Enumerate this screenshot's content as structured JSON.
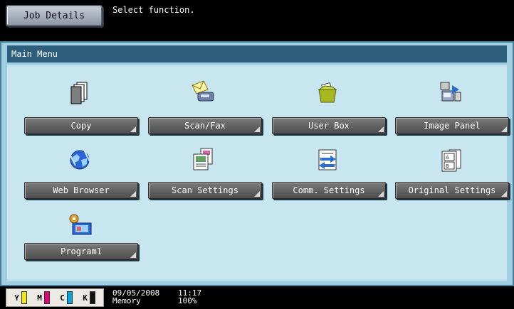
{
  "header": {
    "job_details_label": "Job Details",
    "message": "Select function."
  },
  "main_menu": {
    "title": "Main Menu",
    "items": [
      {
        "label": "Copy",
        "icon": "copy-icon"
      },
      {
        "label": "Scan/Fax",
        "icon": "scan-fax-icon"
      },
      {
        "label": "User Box",
        "icon": "user-box-icon"
      },
      {
        "label": "Image Panel",
        "icon": "image-panel-icon"
      },
      {
        "label": "Web Browser",
        "icon": "web-browser-icon"
      },
      {
        "label": "Scan Settings",
        "icon": "scan-settings-icon"
      },
      {
        "label": "Comm. Settings",
        "icon": "comm-settings-icon"
      },
      {
        "label": "Original Settings",
        "icon": "original-settings-icon"
      },
      {
        "label": "Program1",
        "icon": "program-icon"
      }
    ]
  },
  "status": {
    "toner": [
      {
        "label": "Y",
        "color": "#f2e800"
      },
      {
        "label": "M",
        "color": "#e0007a"
      },
      {
        "label": "C",
        "color": "#00a6e0"
      },
      {
        "label": "K",
        "color": "#111111"
      }
    ],
    "date": "09/05/2008",
    "time": "11:17",
    "memory_label": "Memory",
    "memory_value": "100%"
  }
}
